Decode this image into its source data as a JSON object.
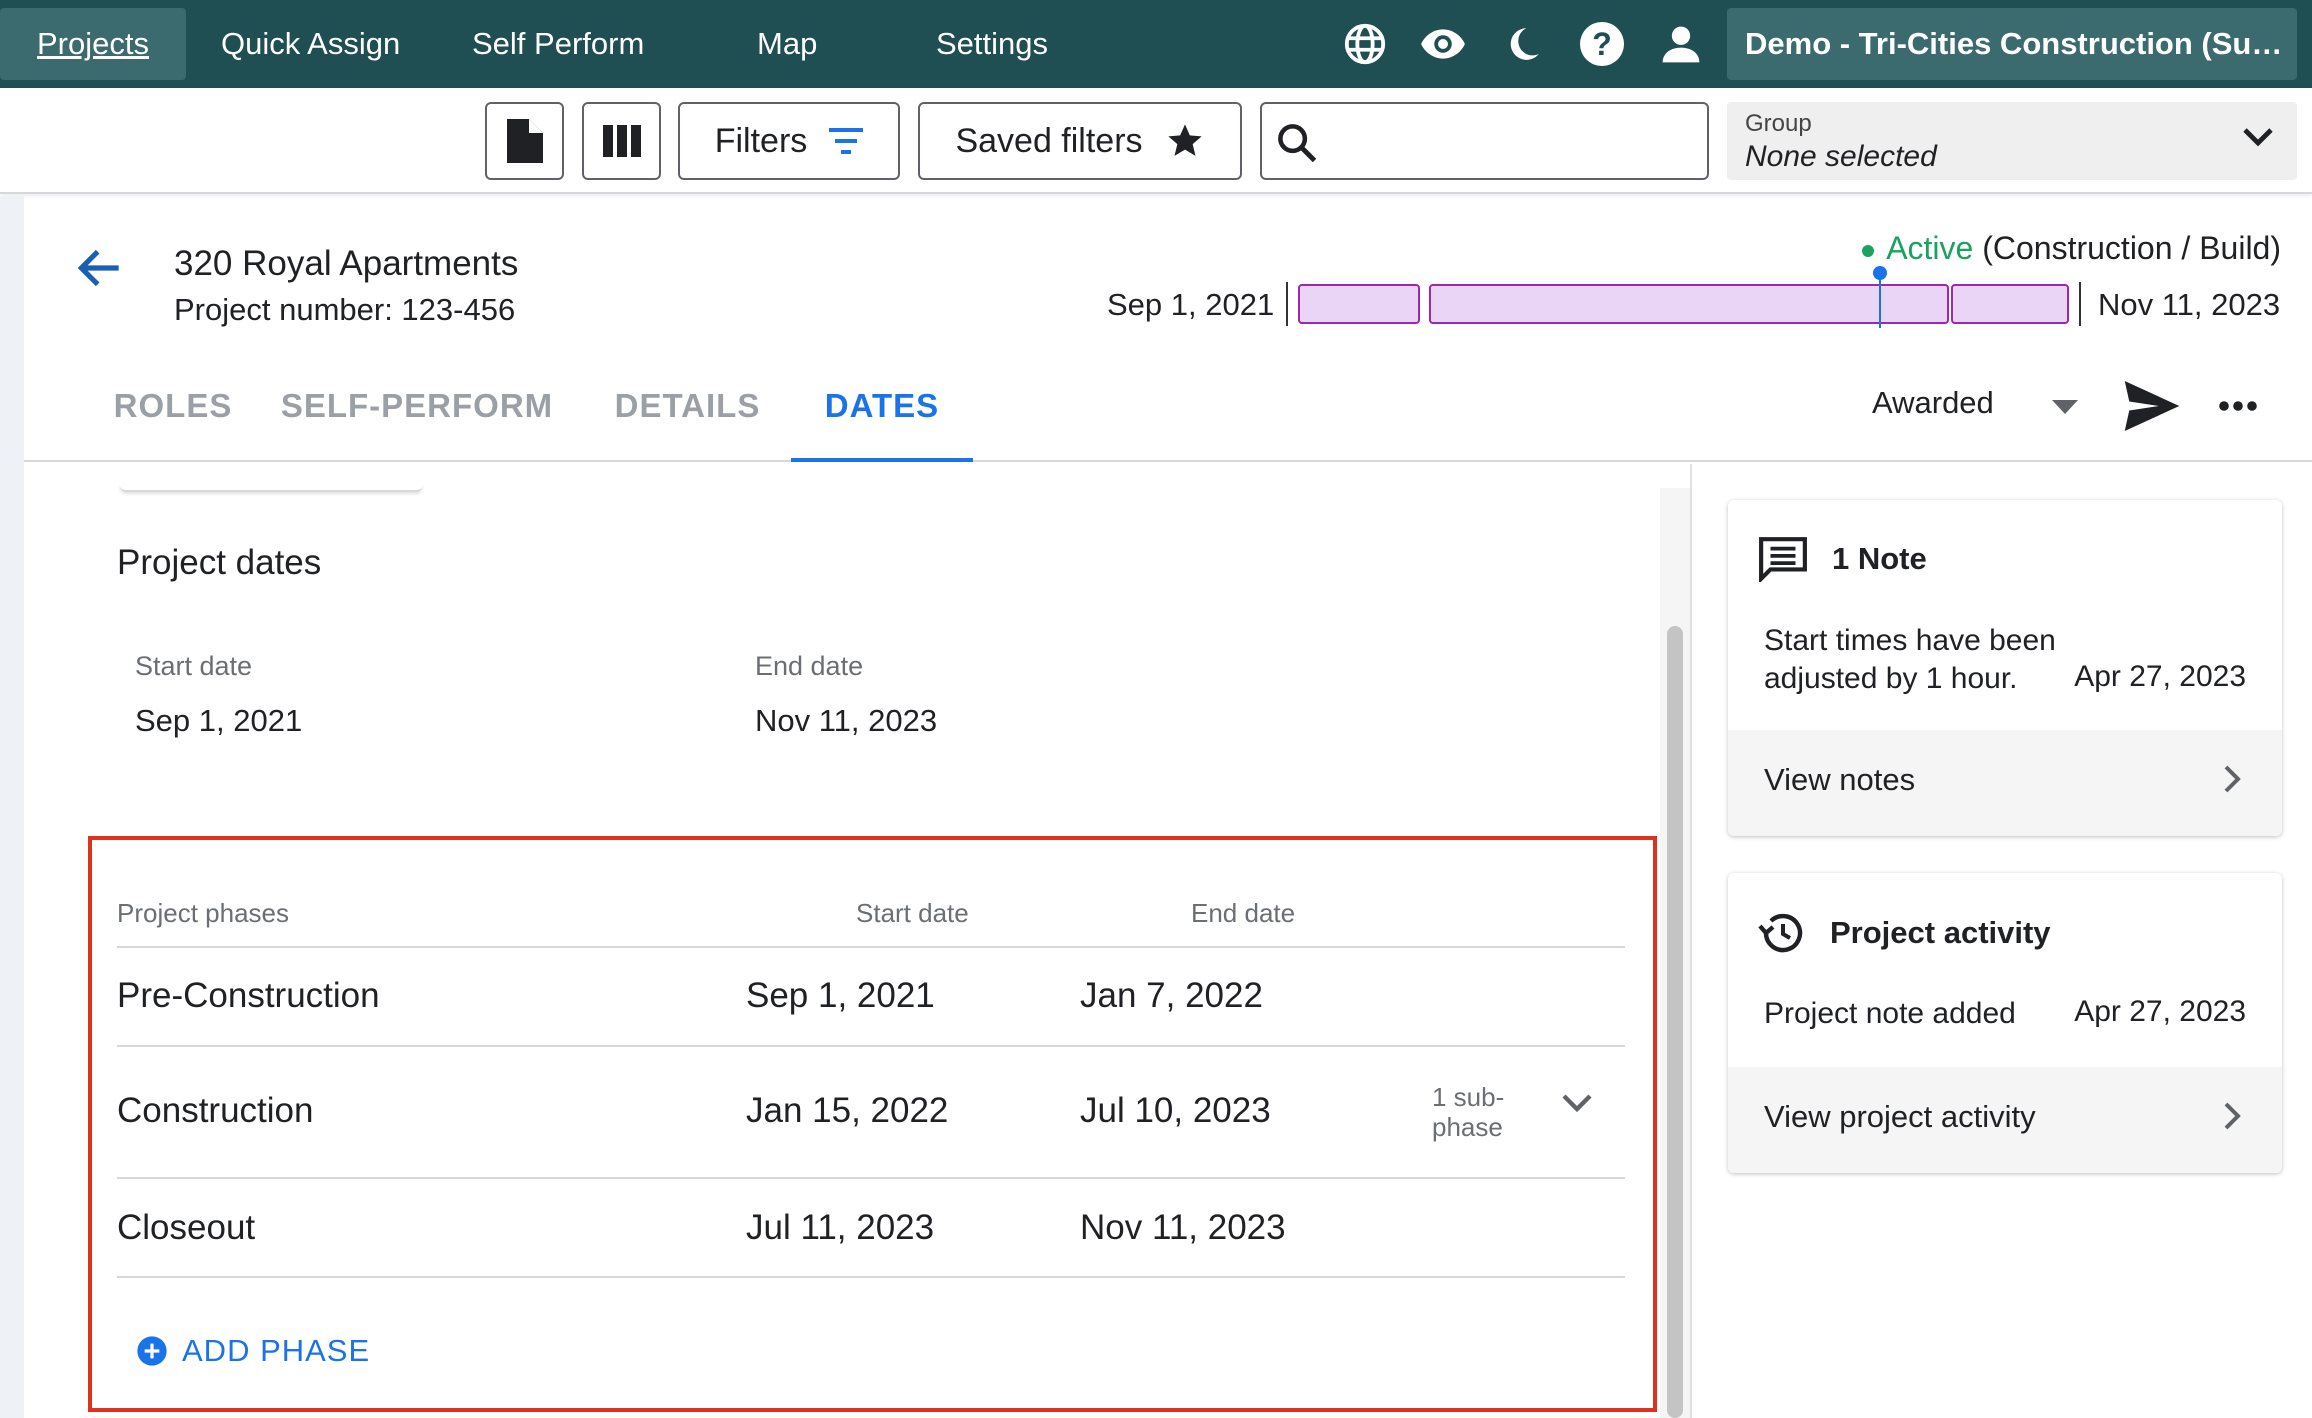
{
  "nav": {
    "items": [
      {
        "label": "Projects",
        "active": true
      },
      {
        "label": "Quick Assign"
      },
      {
        "label": "Self Perform"
      },
      {
        "label": "Map"
      },
      {
        "label": "Settings"
      }
    ],
    "icons": [
      "globe-icon",
      "eye-icon",
      "moon-icon",
      "help-icon",
      "account-icon"
    ],
    "org_name": "Demo - Tri-Cities Construction (Su…",
    "bg_color": "#1f4e53"
  },
  "toolbar": {
    "filters_label": "Filters",
    "saved_filters_label": "Saved filters",
    "search_value": "",
    "group_label": "Group",
    "group_value": "None selected"
  },
  "project": {
    "title": "320 Royal Apartments",
    "number": "Project number: 123-456",
    "status_active": "Active",
    "status_detail": " (Construction / Build)",
    "timeline_start": "Sep 1, 2021",
    "timeline_end": "Nov 11, 2023"
  },
  "tabs": [
    {
      "label": "ROLES"
    },
    {
      "label": "SELF-PERFORM"
    },
    {
      "label": "DETAILS"
    },
    {
      "label": "DATES",
      "active": true
    }
  ],
  "stage": {
    "label": "Awarded"
  },
  "dates": {
    "section_title": "Project dates",
    "start_label": "Start date",
    "start_value": "Sep 1, 2021",
    "end_label": "End date",
    "end_value": "Nov 11, 2023"
  },
  "phases": {
    "headers": {
      "phase": "Project phases",
      "start": "Start date",
      "end": "End date"
    },
    "rows": [
      {
        "name": "Pre-Construction",
        "start": "Sep 1, 2021",
        "end": "Jan 7, 2022"
      },
      {
        "name": "Construction",
        "start": "Jan 15, 2022",
        "end": "Jul 10, 2023",
        "sub": "1 sub-phase"
      },
      {
        "name": "Closeout",
        "start": "Jul 11, 2023",
        "end": "Nov 11, 2023"
      }
    ],
    "add_label": "ADD PHASE"
  },
  "notes_card": {
    "title": "1 Note",
    "text": "Start times have been adjusted by 1 hour.",
    "date": "Apr 27, 2023",
    "footer": "View notes"
  },
  "activity_card": {
    "title": "Project activity",
    "text": "Project note added",
    "date": "Apr 27, 2023",
    "footer": "View project activity"
  },
  "colors": {
    "accent": "#1a73e8",
    "active_green": "#1aa260",
    "highlight_red": "#e0301e",
    "timeline_fill": "#ead5f7",
    "timeline_border": "#9c27b0"
  }
}
